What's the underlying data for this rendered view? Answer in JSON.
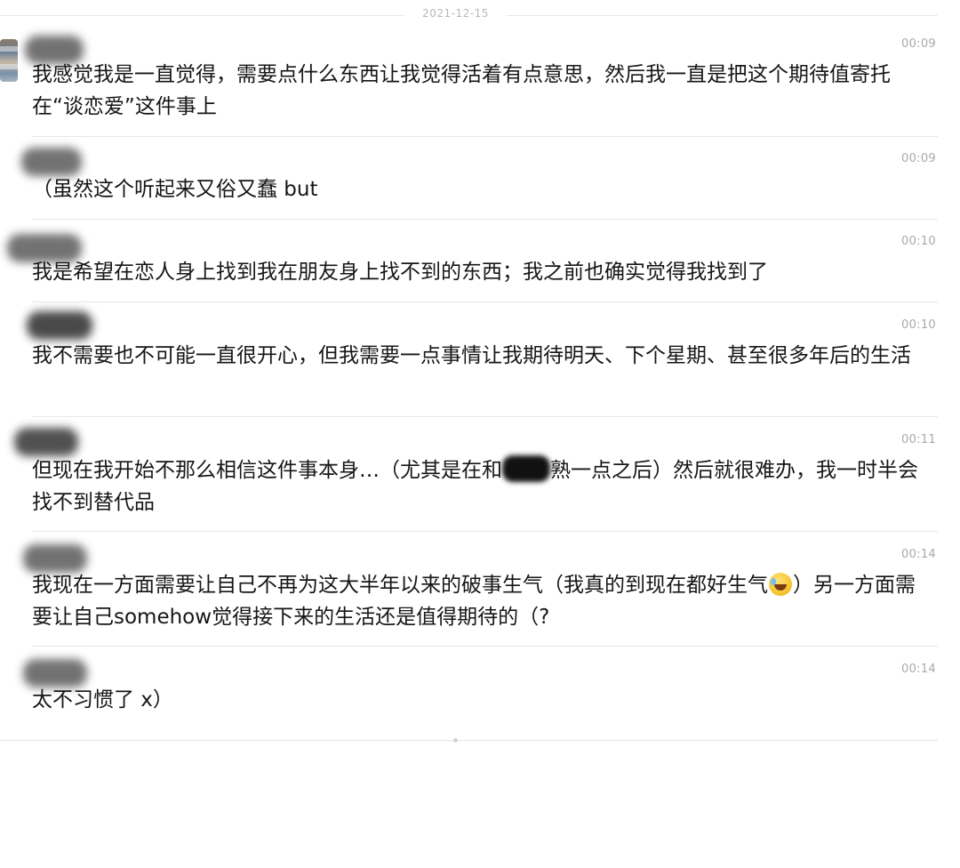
{
  "thread": {
    "date": "2021-12-15"
  },
  "messages": [
    {
      "time": "00:09",
      "text": "我感觉我是一直觉得，需要点什么东西让我觉得活着有点意思，然后我一直是把这个期待值寄托在“谈恋爱”这件事上"
    },
    {
      "time": "00:09",
      "text": "（虽然这个听起来又俗又蠢 but"
    },
    {
      "time": "00:10",
      "text": "我是希望在恋人身上找到我在朋友身上找不到的东西；我之前也确实觉得我找到了"
    },
    {
      "time": "00:10",
      "text": "我不需要也不可能一直很开心，但我需要一点事情让我期待明天、下个星期、甚至很多年后的生活"
    },
    {
      "time": "00:11",
      "text_before": "但现在我开始不那么相信这件事本身…（尤其是在和",
      "text_after": "熟一点之后）然后就很难办，我一时半会找不到替代品"
    },
    {
      "time": "00:14",
      "text_before": "我现在一方面需要让自己不再为这大半年以来的破事生气（我真的到现在都好生气",
      "emoji": "rolling-on-floor-laughing",
      "text_after": "）另一方面需要让自己somehow觉得接下来的生活还是值得期待的（?"
    },
    {
      "time": "00:14",
      "text": "太不习惯了 x）"
    }
  ]
}
